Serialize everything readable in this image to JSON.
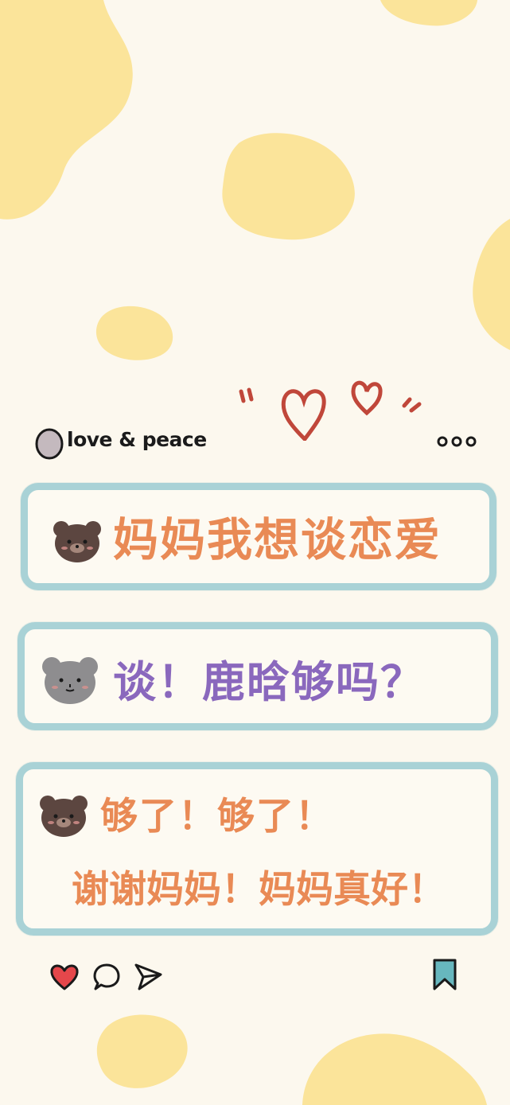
{
  "post": {
    "username": "love & peace",
    "menu_icon": "more-dots-icon",
    "decor_icon": "hearts-doodle-icon"
  },
  "messages": [
    {
      "speaker": "brown-bear",
      "lines": [
        "妈妈我想谈恋爱"
      ],
      "color": "#e98a55"
    },
    {
      "speaker": "gray-bear",
      "lines": [
        "谈！鹿晗够吗？"
      ],
      "color": "#8a68bd"
    },
    {
      "speaker": "brown-bear",
      "lines": [
        "够了！够了！",
        "谢谢妈妈！妈妈真好！"
      ],
      "color": "#e98a55"
    }
  ],
  "actions": {
    "like_icon": "heart-icon",
    "comment_icon": "comment-icon",
    "share_icon": "send-icon",
    "save_icon": "bookmark-icon"
  },
  "colors": {
    "background": "#fcf8ee",
    "blob": "#fbe49a",
    "bubble_border": "#a9d2d6",
    "heart": "#e5474b",
    "bookmark": "#67b7be"
  }
}
